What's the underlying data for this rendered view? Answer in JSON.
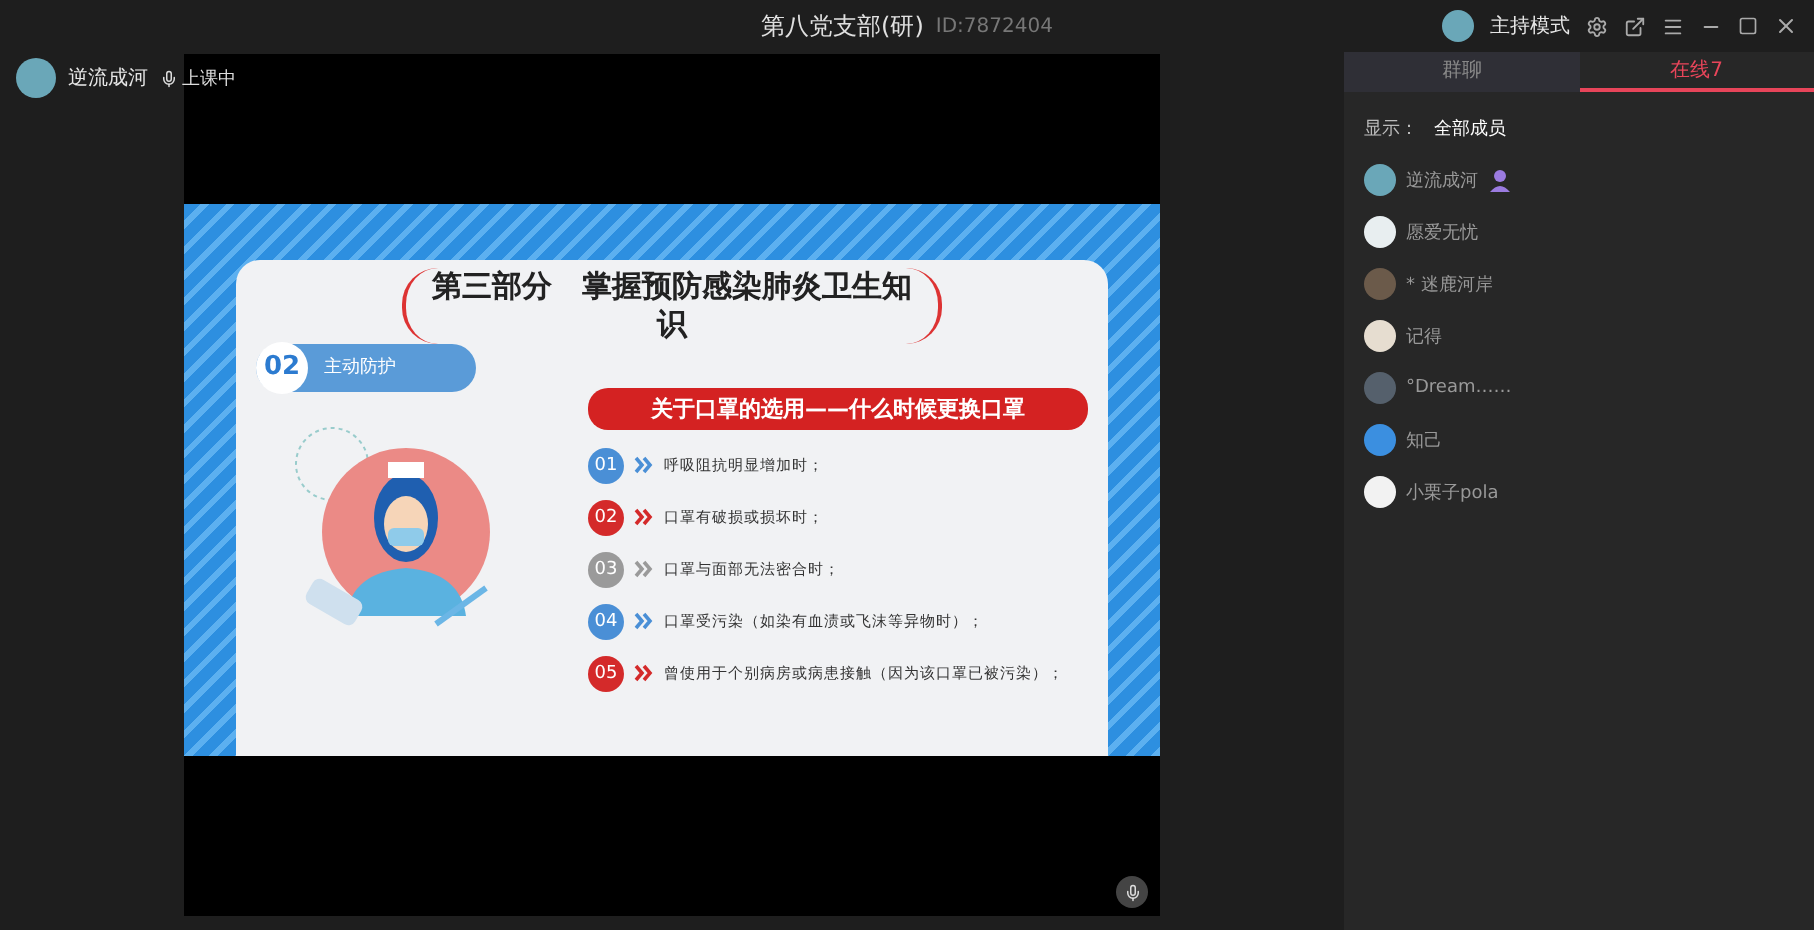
{
  "window": {
    "title": "第八党支部(研)",
    "id": "ID:7872404",
    "host_mode": "主持模式"
  },
  "presenter": {
    "name": "逆流成河",
    "status": "上课中"
  },
  "slide": {
    "heading": "第三部分　掌握预防感染肺炎卫生知识",
    "section_number": "02",
    "section_label": "主动防护",
    "banner": "关于口罩的选用——什么时候更换口罩",
    "items": [
      {
        "number": "01",
        "text": "呼吸阻抗明显增加时；",
        "color": "#4a8fd6"
      },
      {
        "number": "02",
        "text": "口罩有破损或损坏时；",
        "color": "#d42a2a"
      },
      {
        "number": "03",
        "text": "口罩与面部无法密合时；",
        "color": "#9a9a9a"
      },
      {
        "number": "04",
        "text": "口罩受污染（如染有血渍或飞沫等异物时）；",
        "color": "#4a8fd6"
      },
      {
        "number": "05",
        "text": "曾使用于个别病房或病患接触（因为该口罩已被污染）；",
        "color": "#d42a2a"
      }
    ]
  },
  "tabs": [
    {
      "label": "群聊",
      "selected": false
    },
    {
      "label": "在线7",
      "selected": true
    }
  ],
  "filter": {
    "label": "显示：",
    "value": "全部成员"
  },
  "members": [
    {
      "name": "逆流成河",
      "host": true,
      "color": "#6aa7b8"
    },
    {
      "name": "愿爱无忧",
      "host": false,
      "color": "#e8eef0"
    },
    {
      "name": "* 迷鹿河岸",
      "host": false,
      "color": "#6b5a4a"
    },
    {
      "name": "记得",
      "host": false,
      "color": "#e6ddd0"
    },
    {
      "name": "°Dream……",
      "host": false,
      "color": "#55606c"
    },
    {
      "name": "知己",
      "host": false,
      "color": "#3b8fe0"
    },
    {
      "name": "小栗子pola",
      "host": false,
      "color": "#f2f2f2"
    }
  ]
}
